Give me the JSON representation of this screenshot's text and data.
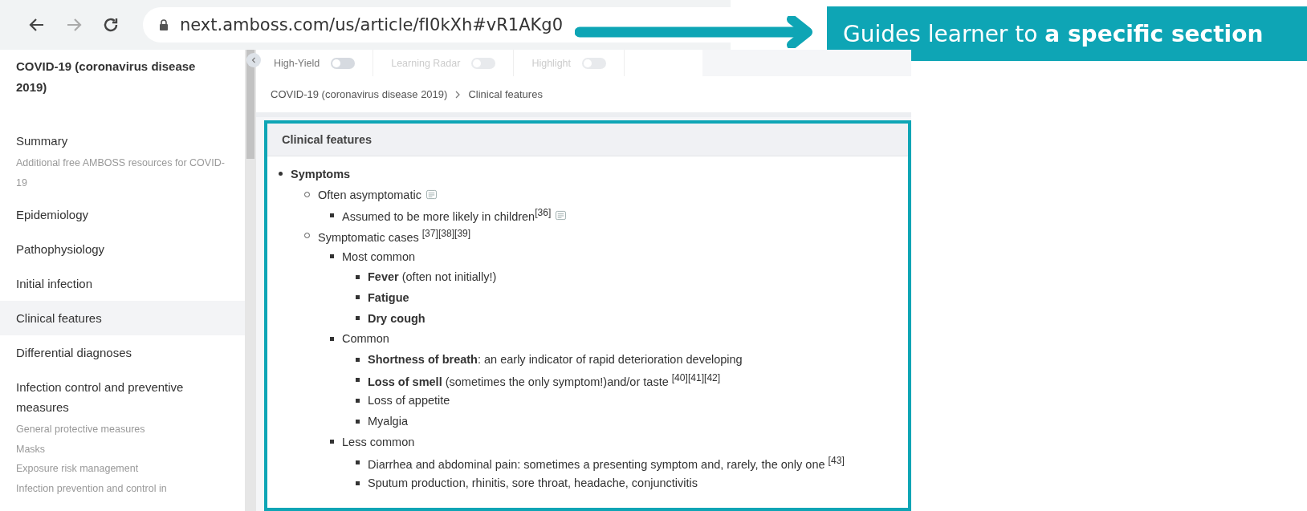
{
  "browser": {
    "url": "next.amboss.com/us/article/fI0kXh#vR1AKg0",
    "forward_disabled": true
  },
  "callout": {
    "text": "Guides learner to **a specific section**"
  },
  "sidebar": {
    "title": "COVID-19 (coronavirus disease 2019)",
    "items": [
      {
        "label": "Summary",
        "selected": false,
        "children": [
          {
            "label": "Additional free AMBOSS resources for COVID-19",
            "selected": false
          }
        ]
      },
      {
        "label": "Epidemiology",
        "selected": false
      },
      {
        "label": "Pathophysiology",
        "selected": false
      },
      {
        "label": "Initial infection",
        "selected": false
      },
      {
        "label": "Clinical features",
        "selected": true
      },
      {
        "label": "Differential diagnoses",
        "selected": false
      },
      {
        "label": "Infection control and preventive measures",
        "selected": false,
        "children": [
          {
            "label": "General protective measures",
            "selected": false
          },
          {
            "label": "Masks",
            "selected": false
          },
          {
            "label": "Exposure risk management",
            "selected": false
          },
          {
            "label": "Infection prevention and control in",
            "selected": false
          }
        ]
      }
    ]
  },
  "toolbar": {
    "toggles": [
      {
        "label": "High-Yield",
        "on": false,
        "disabled": false
      },
      {
        "label": "Learning Radar",
        "on": false,
        "disabled": true
      },
      {
        "label": "Highlight",
        "on": false,
        "disabled": true
      }
    ]
  },
  "breadcrumb": [
    "COVID-19 (coronavirus disease 2019)",
    "Clinical features"
  ],
  "section": {
    "title": "Clinical features",
    "highlighted": true,
    "items": [
      {
        "text": "Symptoms",
        "bold": true,
        "children": [
          {
            "text": "Often asymptomatic",
            "note": true,
            "children": [
              {
                "text": "Assumed to be more likely in children$^{[36]}$",
                "note": true
              }
            ]
          },
          {
            "text": "Symptomatic cases $^{[37][38][39]}$",
            "children": [
              {
                "text": "Most common",
                "children": [
                  {
                    "text": "**Fever** (often not initially!)"
                  },
                  {
                    "text": "Fatigue",
                    "bold": true
                  },
                  {
                    "text": "Dry cough",
                    "bold": true
                  }
                ]
              },
              {
                "text": "Common",
                "children": [
                  {
                    "text": "**Shortness of breath**: an early indicator of rapid deterioration developing"
                  },
                  {
                    "text": "**Loss of smell** (sometimes the only symptom!)and/or taste $^{[40][41][42]}$"
                  },
                  {
                    "text": "Loss of appetite"
                  },
                  {
                    "text": "Myalgia"
                  }
                ]
              },
              {
                "text": "Less common",
                "children": [
                  {
                    "text": "Diarrhea and abdominal pain: sometimes a presenting symptom and, rarely, the only one $^{[43]}$"
                  },
                  {
                    "text": "Sputum production, rhinitis, sore throat, headache, conjunctivitis"
                  }
                ]
              }
            ]
          }
        ]
      }
    ]
  }
}
